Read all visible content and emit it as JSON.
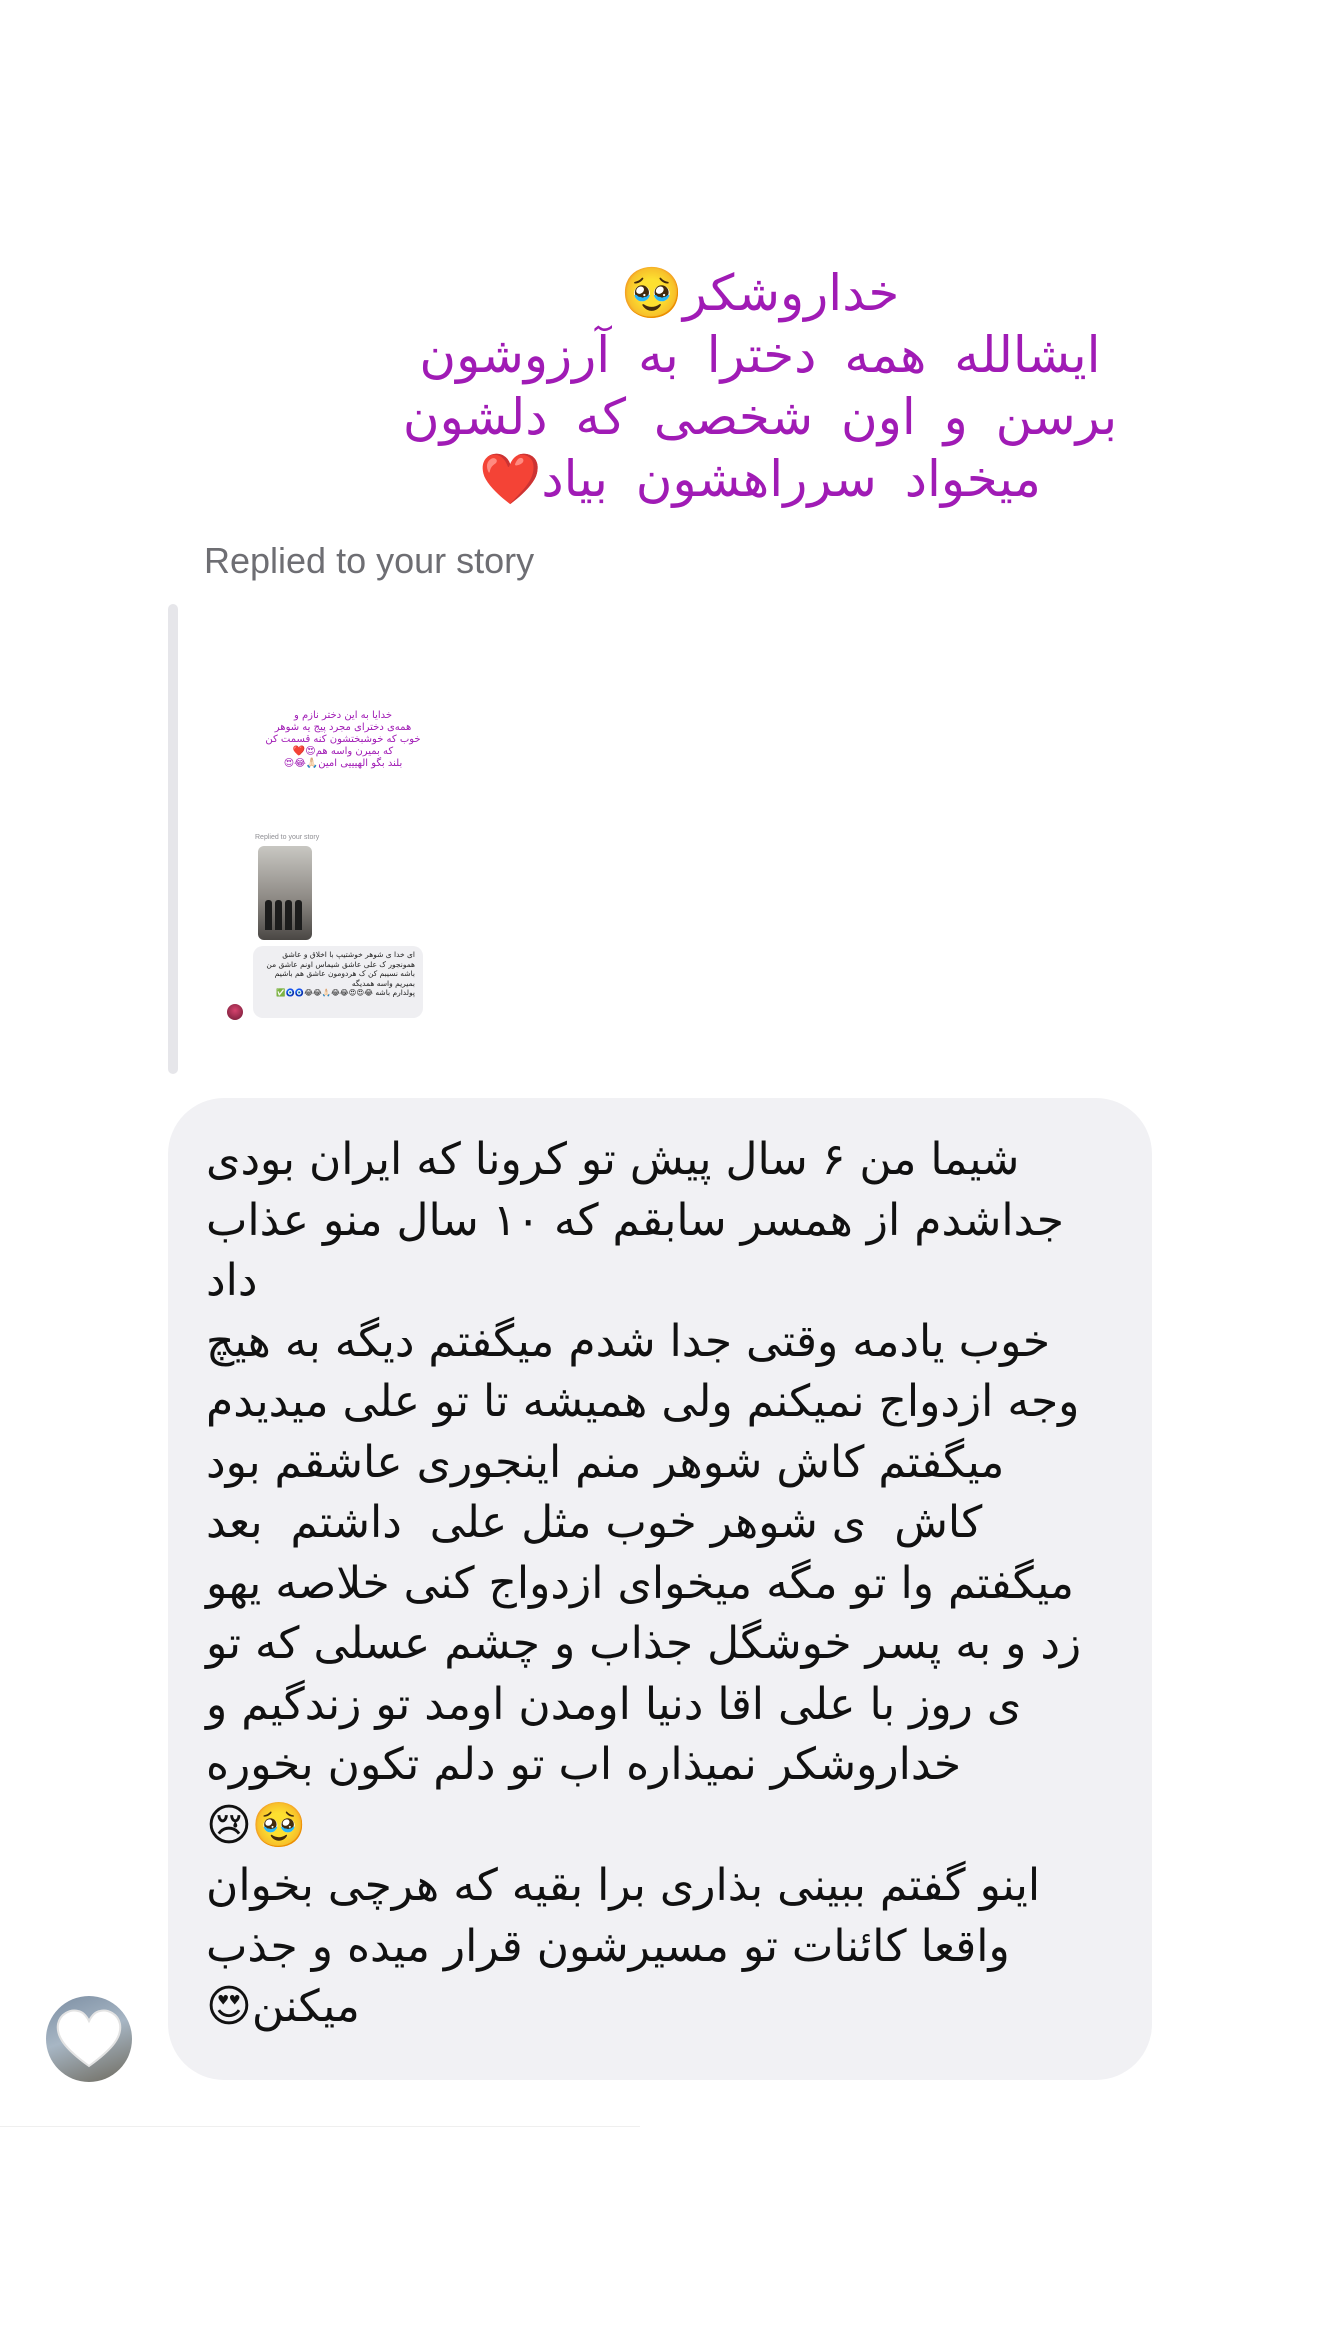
{
  "story_reply": {
    "caption_lines": [
      "خداروشکر🥹",
      "ایشالله همه دخترا به آرزوشون",
      "برسن و اون شخصی که دلشون",
      "میخواد سرراهشون بیاد❤️"
    ],
    "label": "Replied to your story",
    "story_preview": {
      "caption_lines": [
        "خدایا به این دختر نازم و",
        "همه‌ی دخترای مجرد پیج یه شوهر",
        "خوب که خوشبختشون کنه قسمت کن",
        "که بمیرن واسه هم😍❤️",
        "بلند بگو الهیییی امین🙏🏻😂😍"
      ],
      "label": "Replied to your story",
      "bubble_lines": [
        "ای خدا ی شوهر خوشتیپ با اخلاق و عاشق",
        "همونجور ک علی عاشق شیماس اونم عاشق من",
        "باشه نسیبم کن ک هردومون عاشق هم باشیم",
        "بمیریم واسه همدیگه",
        "پولدارم باشه 😂😍😍😂😂🙏🏻😂😂🧿🧿✅"
      ]
    }
  },
  "message": {
    "lines": [
      "شیما من ۶ سال پیش تو کرونا که ایران بودی",
      "جداشدم از همسر سابقم که ۱۰ سال منو عذاب",
      "داد",
      "خوب یادمه وقتی جدا شدم میگفتم دیگه به هیچ",
      "وجه ازدواج نمیکنم ولی همیشه تا تو علی میدیدم",
      "میگفتم کاش شوهر منم اینجوری عاشقم بود",
      "کاش  ی شوهر خوب مثل علی  داشتم  بعد",
      "میگفتم وا تو مگه میخوای ازدواج کنی خلاصه یهو",
      "زد و به پسر خوشگل جذاب و چشم عسلی که تو",
      "ی روز با علی اقا دنیا اومدن اومد تو زندگیم و",
      "خداروشکر نمیذاره اب تو دلم تکون بخوره",
      "🥹😢",
      "اینو گفتم ببینی بذاری برا بقیه که هرچی بخوان",
      "واقعا کائنات تو مسیرشون قرار میده و جذب",
      "میکنن😍"
    ]
  },
  "sender": {
    "avatar_icon": "white-heart-icon"
  },
  "colors": {
    "caption": "#a01bb5",
    "bubble": "#f1f1f4",
    "label": "#6e6e73"
  }
}
